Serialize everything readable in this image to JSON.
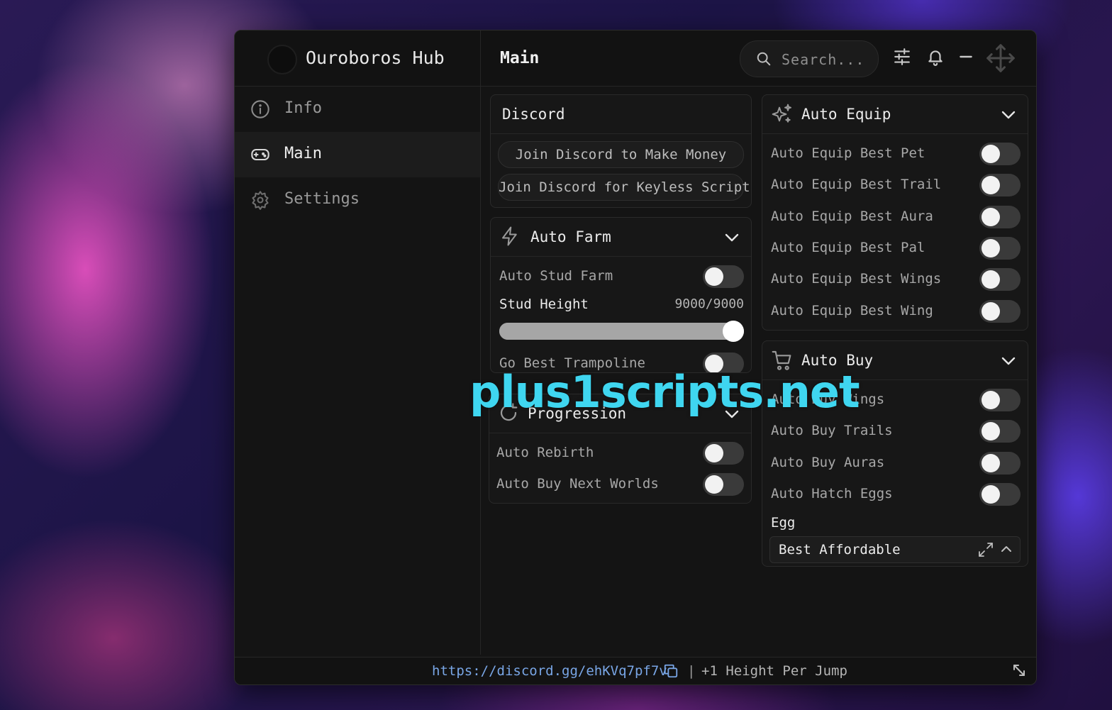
{
  "app": {
    "title": "Ouroboros Hub"
  },
  "header": {
    "page_title": "Main",
    "search_placeholder": "Search..."
  },
  "sidebar": {
    "items": [
      {
        "label": "Info",
        "icon": "info-icon"
      },
      {
        "label": "Main",
        "icon": "gamepad-icon",
        "active": true
      },
      {
        "label": "Settings",
        "icon": "gear-icon"
      }
    ]
  },
  "discord": {
    "title": "Discord",
    "buttons": [
      "Join Discord to Make Money",
      "Join Discord for Keyless Scripts"
    ]
  },
  "auto_farm": {
    "title": "Auto Farm",
    "toggles": [
      "Auto Stud Farm",
      "Go Best Trampoline"
    ],
    "slider": {
      "label": "Stud Height",
      "value_text": "9000/9000",
      "value": 9000,
      "max": 9000
    }
  },
  "progression": {
    "title": "Progression",
    "toggles": [
      "Auto Rebirth",
      "Auto Buy Next Worlds"
    ]
  },
  "auto_equip": {
    "title": "Auto Equip",
    "toggles": [
      "Auto Equip Best Pet",
      "Auto Equip Best Trail",
      "Auto Equip Best Aura",
      "Auto Equip Best Pal",
      "Auto Equip Best Wings",
      "Auto Equip Best Wing"
    ]
  },
  "auto_buy": {
    "title": "Auto Buy",
    "toggles": [
      "Auto Buy Wings",
      "Auto Buy Trails",
      "Auto Buy Auras",
      "Auto Hatch Eggs"
    ],
    "egg_label": "Egg",
    "egg_value": "Best Affordable"
  },
  "footer": {
    "link": "https://discord.gg/ehKVq7pf7v",
    "separator": "|",
    "text": "+1 Height Per Jump"
  },
  "watermark": "plus1scripts.net",
  "colors": {
    "link": "#79a6e6",
    "watermark": "#3fd6f0"
  }
}
